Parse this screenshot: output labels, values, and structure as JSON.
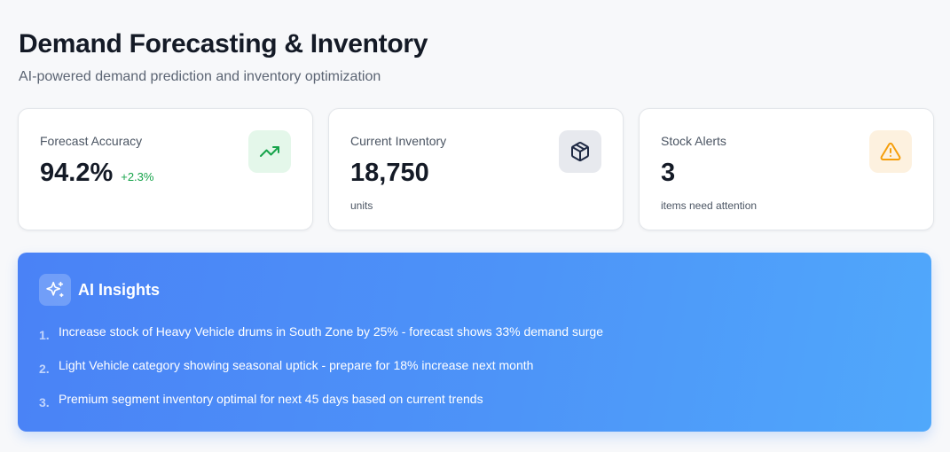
{
  "header": {
    "title": "Demand Forecasting & Inventory",
    "subtitle": "AI-powered demand prediction and inventory optimization"
  },
  "cards": [
    {
      "label": "Forecast Accuracy",
      "value": "94.2%",
      "delta": "+2.3%",
      "sub": "",
      "icon": "trending-up-icon",
      "icon_color": "#16a34a"
    },
    {
      "label": "Current Inventory",
      "value": "18,750",
      "delta": "",
      "sub": "units",
      "icon": "package-icon",
      "icon_color": "#1f2a44"
    },
    {
      "label": "Stock Alerts",
      "value": "3",
      "delta": "",
      "sub": "items need attention",
      "icon": "alert-triangle-icon",
      "icon_color": "#f59e0b"
    }
  ],
  "insights": {
    "title": "AI Insights",
    "icon": "sparkles-icon",
    "items": [
      {
        "number": "1.",
        "text": "Increase stock of Heavy Vehicle drums in South Zone by 25% - forecast shows 33% demand surge"
      },
      {
        "number": "2.",
        "text": "Light Vehicle category showing seasonal uptick - prepare for 18% increase next month"
      },
      {
        "number": "3.",
        "text": "Premium segment inventory optimal for next 45 days based on current trends"
      }
    ]
  },
  "colors": {
    "accent_green": "#16a34a",
    "accent_amber": "#f59e0b",
    "insights_gradient_start": "#4a82f6",
    "insights_gradient_end": "#50a8fb"
  }
}
